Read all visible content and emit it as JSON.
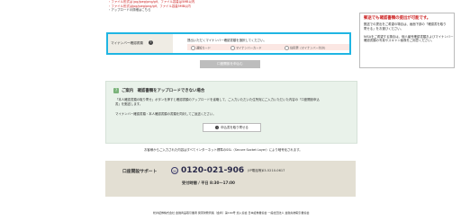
{
  "top_notes": [
    {
      "text": "・ファイル形式は jpg/jpeg/png/gif、ファイル容量は5MB以内",
      "color": "#cc2222"
    },
    {
      "text": "・ファイル形式はjpg/jpeg/png/gif、ファイル容量5MB以内",
      "color": "#cc2222"
    },
    {
      "text": "・アップロードの詳細はこちら",
      "color": "#333333"
    }
  ],
  "side_note": {
    "title": "郵送でも確認書類の提出が可能です。",
    "lines": [
      "郵送での提出をご希望の場合は、画面下部の「確認書を取り",
      "寄せる」をお選びください。",
      "",
      "NISAをご希望する場合は、個人番号確認書類およびマイナンバー",
      "確認書類の写真やスキャン画像をご用意ください。"
    ]
  },
  "upload": {
    "label": "マイナンバー確認書類",
    "required_mark": "?",
    "description": "提出いただくマイナンバー確認書類を選択してください。",
    "options": [
      "通知カード",
      "マイナンバーカード",
      "住民票（マイナンバー付き）"
    ]
  },
  "submit_label": "口座開設を申込む",
  "help": {
    "icon": "?",
    "title": "ご案内　確認書類をアップロードできない場合",
    "body1": [
      "「本人確認書類の取り寄せ」ボタンを押すと確認書類のアップロードを省略して、ご入力いただいた住所宛にご入力いただいた内容の「口座開設申込",
      "書」を郵送します。"
    ],
    "body2": "マイナンバー確認書類・本人確認書類の書類を同封してご返送ください。",
    "order_button": "申込書を取り寄せる"
  },
  "ssl_note": "お客様からご入力された内容はすべてインターネット標準のSSL（Secure Socket Layer）により暗号化されます。",
  "support": {
    "title": "口座開設サポート",
    "phone": "0120-021-906",
    "intl_label": "(IP電話等)",
    "intl_number": "03-5210-0617",
    "hours": "受付時間 / 平日 8:30～17:00"
  },
  "footer": "松井証券株式会社 金融商品取引業者 関東財務局長（金商）第164号 加入協会 日本証券業協会 一般社団法人 金融先物取引業協会",
  "colors": {
    "highlight": "#1fb5e3",
    "alert": "#cc2222"
  }
}
